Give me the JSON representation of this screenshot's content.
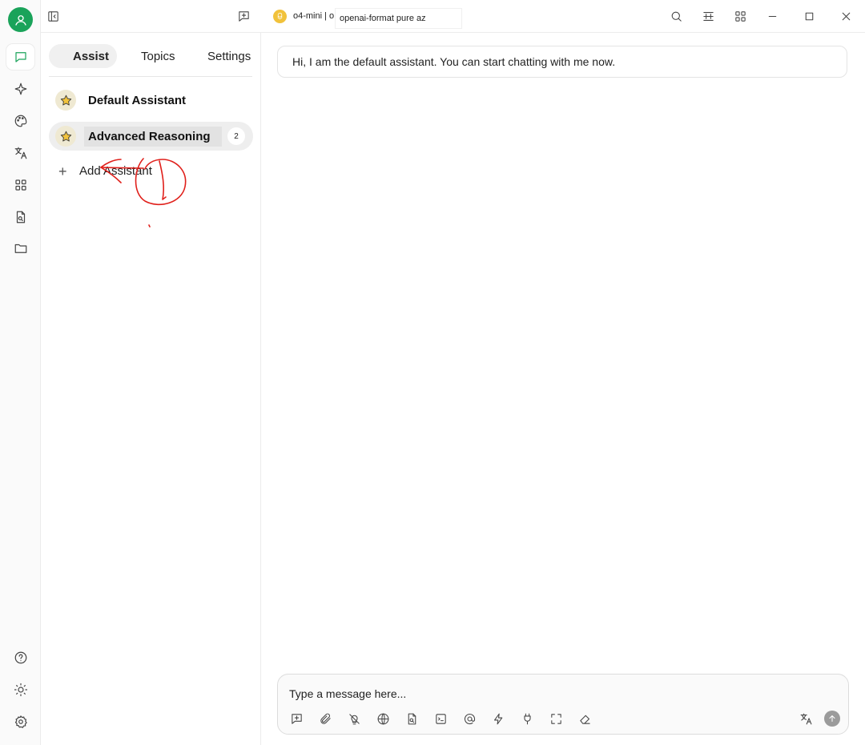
{
  "topbar": {
    "model_label": "o4-mini | o",
    "tooltip": "openai-format pure az"
  },
  "panel": {
    "tabs": [
      {
        "label": "Assist",
        "active": true
      },
      {
        "label": "Topics",
        "active": false
      },
      {
        "label": "Settings",
        "active": false
      }
    ],
    "assistants": [
      {
        "name": "Default Assistant",
        "active": false,
        "badge": ""
      },
      {
        "name": "Advanced Reasoning",
        "active": true,
        "badge": "2"
      }
    ],
    "add_label": "Add Assistant"
  },
  "chat": {
    "welcome": "Hi, I am the default assistant. You can start chatting with me now.",
    "composer_placeholder": "Type a message here..."
  },
  "colors": {
    "accent": "#1aa35a",
    "annotation": "#e0201b",
    "star": "#f2c33c"
  },
  "icons": {
    "rail_top": [
      "chat-icon",
      "sparkle-icon",
      "palette-icon",
      "translate-icon",
      "apps-icon",
      "document-search-icon",
      "folder-icon"
    ],
    "rail_bottom": [
      "help-icon",
      "sun-icon",
      "gear-icon"
    ],
    "toolbar": [
      "new-topic-icon",
      "paperclip-icon",
      "lightbulb-off-icon",
      "globe-icon",
      "knowledge-icon",
      "terminal-icon",
      "at-icon",
      "lightning-icon",
      "plug-icon",
      "fullscreen-icon",
      "eraser-icon"
    ]
  }
}
